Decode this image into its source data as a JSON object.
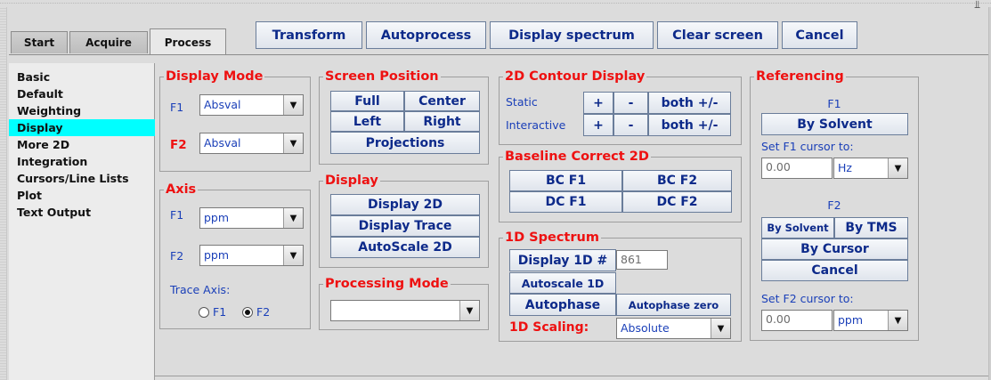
{
  "window": {
    "corner_icon": "pin-icon"
  },
  "tabs": [
    {
      "label": "Start"
    },
    {
      "label": "Acquire"
    },
    {
      "label": "Process"
    }
  ],
  "toolbar": {
    "transform": "Transform",
    "autoprocess": "Autoprocess",
    "display_spectrum": "Display spectrum",
    "clear_screen": "Clear screen",
    "cancel": "Cancel"
  },
  "sidebar": {
    "items": [
      {
        "label": "Basic"
      },
      {
        "label": "Default"
      },
      {
        "label": "Weighting"
      },
      {
        "label": "Display"
      },
      {
        "label": "More 2D"
      },
      {
        "label": "Integration"
      },
      {
        "label": "Cursors/Line Lists"
      },
      {
        "label": "Plot"
      },
      {
        "label": "Text Output"
      }
    ],
    "selected": "Display"
  },
  "display_mode": {
    "title": "Display Mode",
    "f1_label": "F1",
    "f1_value": "Absval",
    "f2_label": "F2",
    "f2_value": "Absval"
  },
  "axis": {
    "title": "Axis",
    "f1_label": "F1",
    "f1_value": "ppm",
    "f2_label": "F2",
    "f2_value": "ppm",
    "trace_axis_label": "Trace Axis:",
    "radio_f1": "F1",
    "radio_f2": "F2",
    "selected": "F2"
  },
  "screen_position": {
    "title": "Screen Position",
    "full": "Full",
    "center": "Center",
    "left": "Left",
    "right": "Right",
    "projections": "Projections"
  },
  "display": {
    "title": "Display",
    "display_2d": "Display 2D",
    "display_trace": "Display Trace",
    "autoscale_2d": "AutoScale 2D"
  },
  "processing_mode": {
    "title": "Processing Mode",
    "value": ""
  },
  "contour": {
    "title": "2D Contour Display",
    "static_label": "Static",
    "interactive_label": "Interactive",
    "plus": "+",
    "minus": "-",
    "both": "both +/-"
  },
  "baseline": {
    "title": "Baseline Correct 2D",
    "bc_f1": "BC F1",
    "bc_f2": "BC F2",
    "dc_f1": "DC F1",
    "dc_f2": "DC F2"
  },
  "spectrum_1d": {
    "title": "1D Spectrum",
    "display_1d": "Display 1D #",
    "display_1d_value": "861",
    "autoscale_1d": "Autoscale 1D",
    "autophase": "Autophase",
    "autophase_zero": "Autophase zero",
    "scaling_label": "1D Scaling:",
    "scaling_value": "Absolute"
  },
  "referencing": {
    "title": "Referencing",
    "f1_label": "F1",
    "f1_by_solvent": "By Solvent",
    "f1_cursor_label": "Set F1 cursor to:",
    "f1_cursor_value": "0.00",
    "f1_unit": "Hz",
    "f2_label": "F2",
    "f2_by_solvent": "By Solvent",
    "f2_by_tms": "By TMS",
    "f2_by_cursor": "By Cursor",
    "f2_cancel": "Cancel",
    "f2_cursor_label": "Set F2 cursor to:",
    "f2_cursor_value": "0.00",
    "f2_unit": "ppm"
  }
}
